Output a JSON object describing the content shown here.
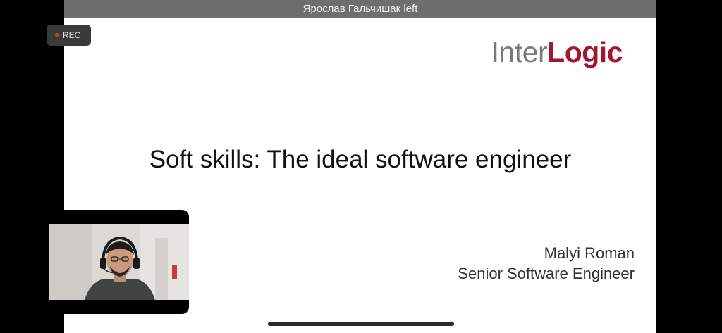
{
  "notification": {
    "text": "Ярослав Гальчишак left"
  },
  "recording": {
    "label": "REC"
  },
  "slide": {
    "logo": {
      "part1": "Inter",
      "part2": "Logic"
    },
    "title": "Soft skills: The ideal software engineer",
    "presenter": {
      "name": "Malyi Roman",
      "role": "Senior Software Engineer"
    }
  },
  "colors": {
    "brand_red": "#a0172f",
    "brand_gray": "#7a7a7a",
    "notification_bar": "#6e6e6e",
    "record_dot": "#c43b3b"
  },
  "icons": {
    "recording_indicator": "record-dot-icon",
    "participant_video": "participant-video"
  }
}
